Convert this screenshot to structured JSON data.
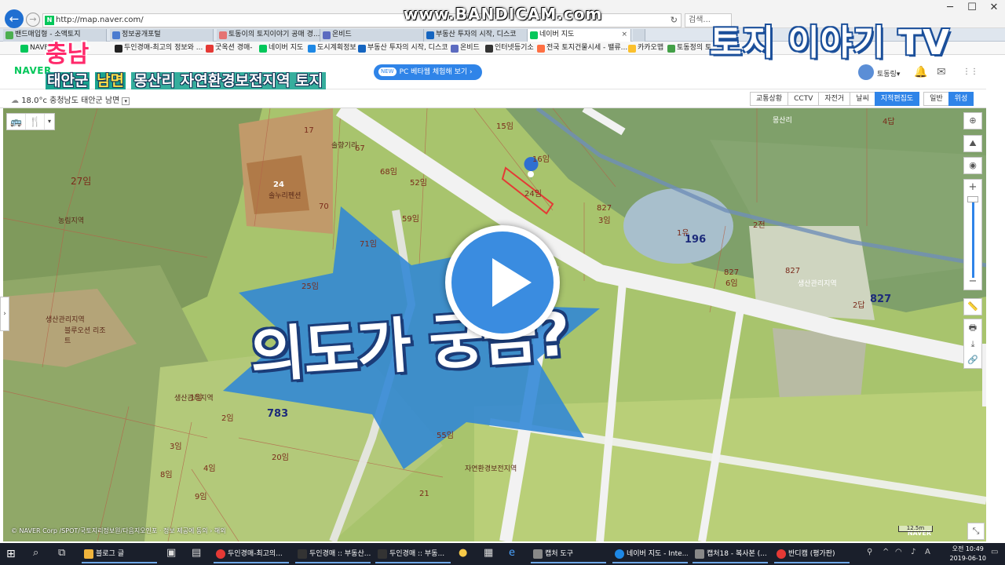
{
  "browser": {
    "url": "http://map.naver.com/",
    "search_placeholder": "검색...",
    "refresh": "↻",
    "tabs": [
      {
        "label": "밴드매입형 - 소액토지",
        "color": "#4caf50"
      },
      {
        "label": "정보공개포털",
        "color": "#4a7bd0"
      },
      {
        "label": "토동이의 토지이야기 공매 경...",
        "color": "#e57373"
      },
      {
        "label": "온비드",
        "color": "#5c6bc0"
      },
      {
        "label": "부동산 투자의 시작, 디스코",
        "color": "#1565c0"
      },
      {
        "label": "네이버 지도",
        "color": "#03c75a"
      }
    ],
    "active_tab_close": "×",
    "bookmarks": [
      {
        "label": "NAVER",
        "color": "#03c75a"
      },
      {
        "label": "두인경매-최고의 정보와 ...",
        "color": "#222"
      },
      {
        "label": "굿옥션 경매-",
        "color": "#e53935"
      },
      {
        "label": "네이버 지도",
        "color": "#03c75a"
      },
      {
        "label": "도시계획정보",
        "color": "#1e88e5"
      },
      {
        "label": "부동산 투자의 시작, 디스코",
        "color": "#1565c0"
      },
      {
        "label": "온비드",
        "color": "#5c6bc0"
      },
      {
        "label": "인터넷등기소",
        "color": "#333"
      },
      {
        "label": "전국 토지건물시세 - 밸류...",
        "color": "#ff7043"
      },
      {
        "label": "카카오맵",
        "color": "#fbc02d"
      },
      {
        "label": "토동정의 토",
        "color": "#43a047"
      }
    ]
  },
  "watermark": "www.BANDICAM.com",
  "naver": {
    "logo": "NAVER",
    "pc_beta_new": "NEW",
    "pc_beta_label": "PC 베타웹 체험해 보기",
    "pc_beta_arrow": "›",
    "user_name": "토동링",
    "user_caret": "▾",
    "icons": {
      "bell": "🔔",
      "mail": "✉",
      "apps": "⋮⋮"
    }
  },
  "weather": {
    "temp": "18.0°c",
    "location": "충청남도 태안군 남면",
    "caret": "▾"
  },
  "layers": [
    {
      "label": "교통상황",
      "on": false
    },
    {
      "label": "CCTV",
      "on": false
    },
    {
      "label": "자전거",
      "on": false
    },
    {
      "label": "날씨",
      "on": false
    },
    {
      "label": "지적편집도",
      "on": true
    },
    {
      "label": "일반",
      "on": false
    },
    {
      "label": "위성",
      "on": true
    }
  ],
  "map": {
    "lots": [
      {
        "text": "17",
        "big": false
      },
      {
        "text": "15임",
        "big": false
      },
      {
        "text": "16임",
        "big": false
      },
      {
        "text": "4답",
        "big": false
      },
      {
        "text": "67",
        "big": false
      },
      {
        "text": "68임",
        "big": false
      },
      {
        "text": "52임",
        "big": false
      },
      {
        "text": "24",
        "big": false
      },
      {
        "text": "70",
        "big": false
      },
      {
        "text": "27임",
        "big": false
      },
      {
        "text": "59임",
        "big": false
      },
      {
        "text": "24임",
        "big": false
      },
      {
        "text": "827",
        "big": false
      },
      {
        "text": "3임",
        "big": false
      },
      {
        "text": "1유",
        "big": false
      },
      {
        "text": "196",
        "big": true
      },
      {
        "text": "2전",
        "big": false
      },
      {
        "text": "71임",
        "big": false
      },
      {
        "text": "827",
        "big": false
      },
      {
        "text": "6임",
        "big": false
      },
      {
        "text": "827",
        "big": false
      },
      {
        "text": "25임",
        "big": false
      },
      {
        "text": "2답",
        "big": false
      },
      {
        "text": "827",
        "big": true
      },
      {
        "text": "783",
        "big": true
      },
      {
        "text": "1임",
        "big": false
      },
      {
        "text": "2임",
        "big": false
      },
      {
        "text": "55임",
        "big": false
      },
      {
        "text": "3임",
        "big": false
      },
      {
        "text": "4임",
        "big": false
      },
      {
        "text": "20임",
        "big": false
      },
      {
        "text": "8임",
        "big": false
      },
      {
        "text": "9임",
        "big": false
      },
      {
        "text": "21",
        "big": false
      }
    ],
    "zones": [
      "몽산리",
      "솔향기리",
      "솔누리펜션",
      "농림지역",
      "생산관리지역",
      "블루오션 리조트",
      "생산관리지역",
      "생산관리지역",
      "자연환경보전지역"
    ],
    "copyright": "© NAVER Corp /SPOT/국토지리정보원/다음지오인포 · 정보 제공에 동의 › 해외",
    "brand": "NAVER",
    "scale": "12.5m"
  },
  "tools": {
    "bus": "🚌",
    "food": "🍴",
    "caret": "▾",
    "side_arrow": "›",
    "locate": "⊕",
    "zoom_in": "+",
    "zoom_out": "−",
    "ruler": "📏",
    "print": "🖶",
    "save": "⤓",
    "link": "🔗",
    "corner": "⤡"
  },
  "overlay": {
    "province": "충남",
    "county": "태안군",
    "town": "남면",
    "rest": "몽산리 자연환경보전지역 토지",
    "brand_tv": "토지 이야기 TV",
    "question": "의도가 궁금?"
  },
  "taskbar": {
    "start": "⊞",
    "items": [
      {
        "label": "블로그 글",
        "color": "#f0b43c"
      },
      {
        "label": "두인경매-최고의...",
        "color": "#e53935"
      },
      {
        "label": "두인경매 :: 부동산...",
        "color": "#333"
      },
      {
        "label": "두인경매 :: 부동...",
        "color": "#333"
      },
      {
        "label": "캡처 도구",
        "color": "#888"
      },
      {
        "label": "네이버 지도 - Inte...",
        "color": "#1e88e5"
      },
      {
        "label": "캡처18 - 복사본 (...",
        "color": "#888"
      },
      {
        "label": "반디캠 (평가판)",
        "color": "#e53935"
      }
    ],
    "tray_expand": "^",
    "tray_lang": "A",
    "time": "오전 10:49",
    "date": "2019-06-10"
  }
}
